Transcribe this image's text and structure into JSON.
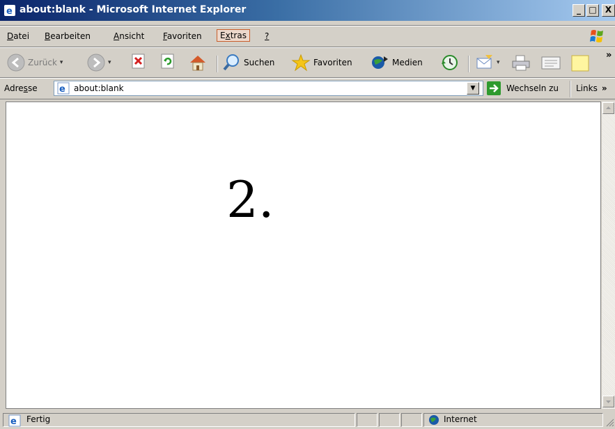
{
  "window": {
    "title": "about:blank - Microsoft Internet Explorer",
    "minimize": "_",
    "maximize": "□",
    "close": "X"
  },
  "menu": {
    "items": [
      {
        "pre": "",
        "key": "D",
        "post": "atei"
      },
      {
        "pre": "",
        "key": "B",
        "post": "earbeiten"
      },
      {
        "pre": "",
        "key": "A",
        "post": "nsicht"
      },
      {
        "pre": "",
        "key": "F",
        "post": "avoriten"
      },
      {
        "pre": "E",
        "key": "x",
        "post": "tras"
      },
      {
        "pre": "",
        "key": "?",
        "post": ""
      }
    ]
  },
  "toolbar": {
    "back_label": "Zurück",
    "search_label": "Suchen",
    "favorites_label": "Favoriten",
    "media_label": "Medien",
    "chevron": "»"
  },
  "address": {
    "label_pre": "Adre",
    "label_key": "s",
    "label_post": "se",
    "url": "about:blank",
    "go_label": "Wechseln zu",
    "links_label": "Links",
    "chevron": "»"
  },
  "content": {
    "text": "2."
  },
  "status": {
    "text": "Fertig",
    "zone": "Internet"
  },
  "colors": {
    "titlebar_start": "#0a246a",
    "titlebar_end": "#a6caf0",
    "chrome": "#d4d0c8",
    "menu_highlight_border": "#c95e2b"
  }
}
